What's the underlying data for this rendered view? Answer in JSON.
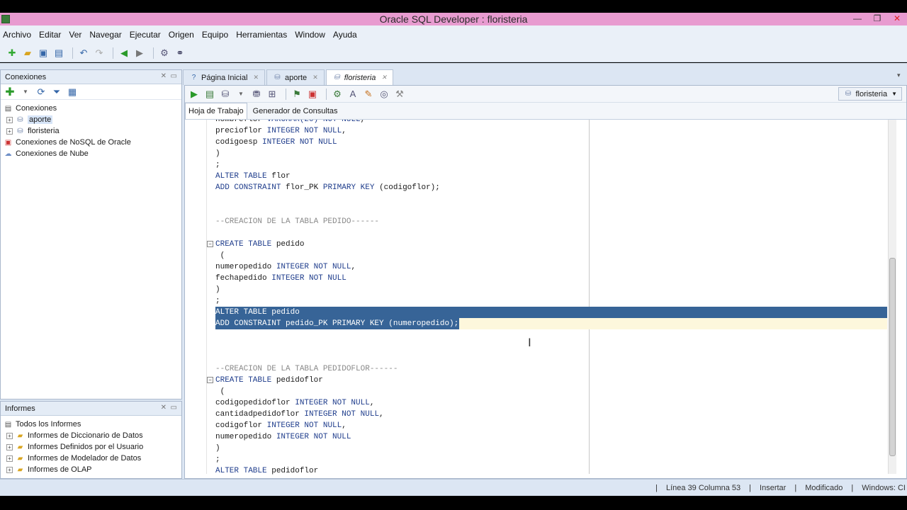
{
  "window": {
    "title": "Oracle SQL Developer : floristeria"
  },
  "menu": [
    "Archivo",
    "Editar",
    "Ver",
    "Navegar",
    "Ejecutar",
    "Origen",
    "Equipo",
    "Herramientas",
    "Window",
    "Ayuda"
  ],
  "connections_panel": {
    "title": "Conexiones",
    "root": "Conexiones",
    "items": [
      "aporte",
      "floristeria"
    ],
    "nosql": "Conexiones de NoSQL de Oracle",
    "cloud": "Conexiones de Nube"
  },
  "reports_panel": {
    "title": "Informes",
    "root": "Todos los Informes",
    "items": [
      "Informes de Diccionario de Datos",
      "Informes Definidos por el Usuario",
      "Informes de Modelador de Datos",
      "Informes de OLAP"
    ]
  },
  "tabs": [
    {
      "label": "Página Inicial"
    },
    {
      "label": "aporte"
    },
    {
      "label": "floristeria"
    }
  ],
  "editor": {
    "connection": "floristeria",
    "subtabs": [
      "Hoja de Trabajo",
      "Generador de Consultas"
    ]
  },
  "status": {
    "position": "Línea 39 Columna 53",
    "mode": "Insertar",
    "state": "Modificado",
    "eol": "Windows: CI"
  }
}
